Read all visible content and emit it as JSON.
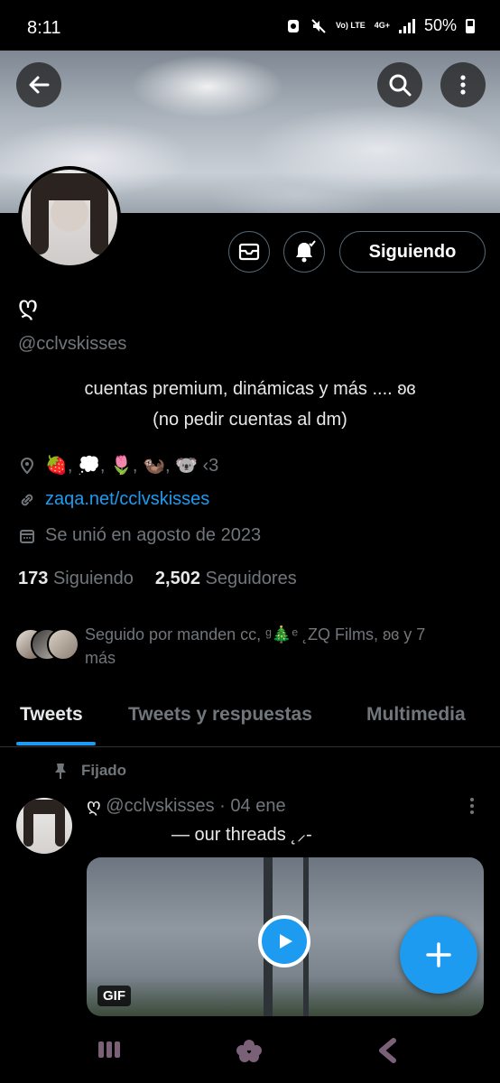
{
  "status_bar": {
    "time": "8:11",
    "network": "Vo) LTE",
    "network_type": "4G+",
    "battery": "50%"
  },
  "profile": {
    "display_name": "ღ",
    "handle": "@cclvskisses",
    "bio_line1": "cuentas premium, dinámicas y más .... ʚɞ",
    "bio_line2": "(no pedir cuentas al dm)",
    "location": "🍓, 💭, 🌷, 🦦, 🐨 ‹3",
    "website": "zaqa.net/cclvskisses",
    "joined": "Se unió en agosto de 2023",
    "following_count": "173",
    "following_label": "Siguiendo",
    "followers_count": "2,502",
    "followers_label": "Seguidores",
    "followed_by_line1": "Seguido por manden cc, ᵍ🎄ᵉ ˛ZQ Films, ʚɞ y 7",
    "followed_by_line2": "más"
  },
  "actions": {
    "follow_button": "Siguiendo"
  },
  "tabs": [
    {
      "label": "Tweets",
      "active": true
    },
    {
      "label": "Tweets y respuestas",
      "active": false
    },
    {
      "label": "Multimedia",
      "active": false
    }
  ],
  "tweet": {
    "pinned_label": "Fijado",
    "author_heart": "ღ",
    "author_handle": "@cclvskisses",
    "date": "· 04 ene",
    "text": "—  our threads ˛⸝-",
    "media_badge": "GIF"
  },
  "colors": {
    "accent": "#1d9bf0",
    "background": "#000000",
    "muted_text": "#71767b"
  },
  "icons": {
    "back": "arrow-left-icon",
    "search": "search-icon",
    "more": "more-vertical-icon",
    "message": "envelope-icon",
    "notify": "bell-check-icon",
    "location": "location-pin-icon",
    "link": "link-icon",
    "calendar": "calendar-icon",
    "pin": "pin-icon",
    "play": "play-icon",
    "compose": "plus-icon",
    "nav_recents": "recents-icon",
    "nav_home": "home-icon",
    "nav_back": "back-icon"
  }
}
